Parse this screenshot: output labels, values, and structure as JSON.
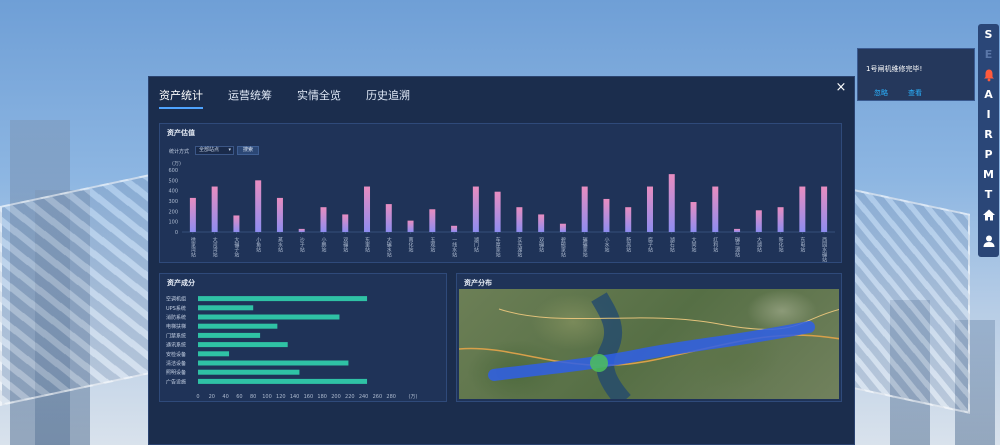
{
  "tabs": [
    {
      "label": "资产统计"
    },
    {
      "label": "运营统筹"
    },
    {
      "label": "实情全览"
    },
    {
      "label": "历史追溯"
    }
  ],
  "close_label": "×",
  "valuation": {
    "title": "资产估值",
    "filter_label": "统计方式",
    "filter_value": "全部站点",
    "search_label": "搜索",
    "chart_data": {
      "type": "bar",
      "ylabel": "(万)",
      "ylim": [
        0,
        600
      ],
      "yticks": [
        "600",
        "500",
        "400",
        "300",
        "200",
        "100",
        "0"
      ],
      "categories": [
        "徐家湾站",
        "大河湾站",
        "大碾子站",
        "小鱼站",
        "蒸水站",
        "沙子站",
        "小鹏站",
        "双碾站",
        "东里站",
        "大碾水站",
        "南化站",
        "五观站",
        "一线水站",
        "湖门站",
        "车厚家站",
        "互光湖站",
        "双碾站",
        "碧碗家站",
        "碾碾家站",
        "小水站",
        "新高站",
        "腐子站",
        "湖石站",
        "大同站",
        "红利站",
        "碾兰湖站",
        "大湖站",
        "新化站",
        "东电站",
        "西园水碾站"
      ],
      "values": [
        330,
        440,
        160,
        500,
        330,
        30,
        240,
        170,
        440,
        270,
        110,
        220,
        60,
        440,
        390,
        240,
        170,
        80,
        440,
        320,
        240,
        440,
        560,
        290,
        440,
        30,
        210,
        240,
        440,
        440
      ]
    }
  },
  "composition": {
    "title": "资产成分",
    "chart_data": {
      "type": "bar",
      "orientation": "horizontal",
      "categories": [
        "空调机组",
        "UPS系统",
        "消防系统",
        "电梯扶梯",
        "门禁系统",
        "通讯系统",
        "安检设备",
        "清洁设备",
        "照明设备",
        "广告设施"
      ],
      "values": [
        245,
        80,
        205,
        115,
        90,
        130,
        45,
        218,
        147,
        245
      ],
      "xlim": [
        0,
        300
      ],
      "xticks": [
        "0",
        "20",
        "40",
        "60",
        "80",
        "100",
        "120",
        "140",
        "160",
        "180",
        "200",
        "220",
        "240",
        "260",
        "280"
      ],
      "unit": "(万)",
      "color": "#2fc2a5"
    }
  },
  "distribution": {
    "title": "资产分布"
  },
  "notification": {
    "message": "1号闸机维修完毕!",
    "ignore_label": "忽略",
    "view_label": "查看"
  },
  "toolbar": {
    "items": [
      {
        "label": "S",
        "icon": "letter"
      },
      {
        "label": "E",
        "icon": "letter"
      },
      {
        "label": "",
        "icon": "bell-icon"
      },
      {
        "label": "A",
        "icon": "letter"
      },
      {
        "label": "I",
        "icon": "letter"
      },
      {
        "label": "R",
        "icon": "letter"
      },
      {
        "label": "P",
        "icon": "letter"
      },
      {
        "label": "M",
        "icon": "letter"
      },
      {
        "label": "T",
        "icon": "letter"
      },
      {
        "label": "",
        "icon": "home-icon"
      },
      {
        "label": "",
        "icon": "user-icon"
      }
    ]
  },
  "colors": {
    "modal_bg": "#1b2d4d",
    "accent": "#4ea3ff",
    "bar_top": "#e88dc0",
    "bar_bottom": "#8e8df0",
    "hbar": "#2fc2a5",
    "route": "#2f5fe8"
  }
}
